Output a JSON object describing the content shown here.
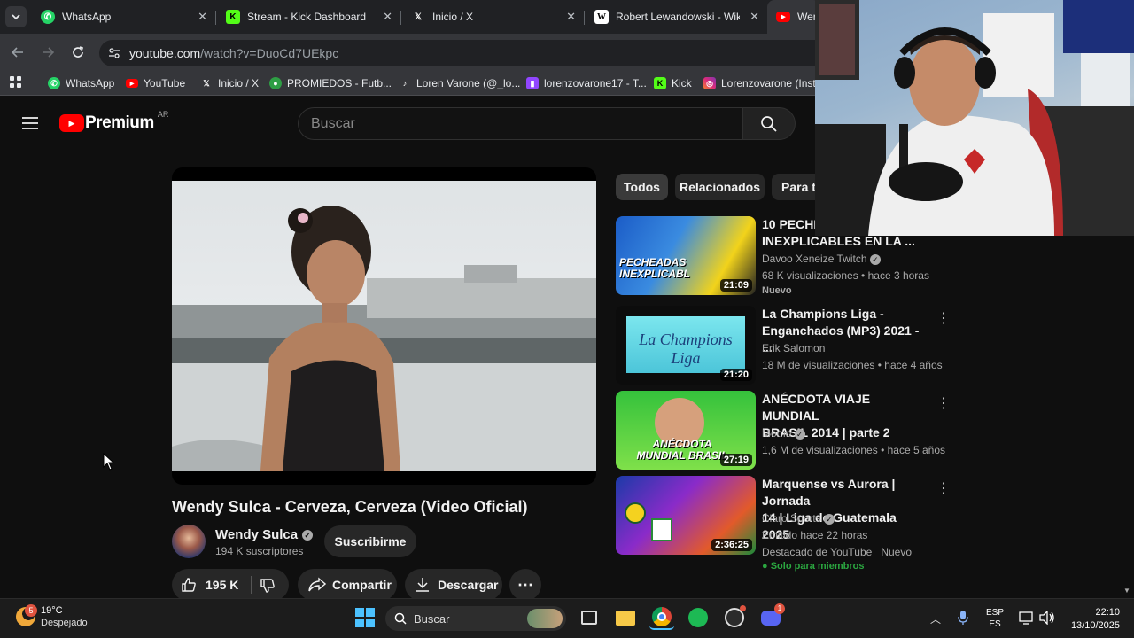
{
  "browser": {
    "tabs": [
      {
        "title": "WhatsApp",
        "icon": "whatsapp-icon"
      },
      {
        "title": "Stream - Kick Dashboard",
        "icon": "kick-icon"
      },
      {
        "title": "Inicio / X",
        "icon": "x-icon"
      },
      {
        "title": "Robert Lewandowski - Wikip",
        "icon": "wikipedia-icon"
      },
      {
        "title": "Wen",
        "icon": "youtube-icon"
      }
    ],
    "url_domain": "youtube.com",
    "url_path": "/watch?v=DuoCd7UEkpc",
    "bookmarks": [
      {
        "label": "WhatsApp",
        "icon": "whatsapp-icon"
      },
      {
        "label": "YouTube",
        "icon": "youtube-icon"
      },
      {
        "label": "Inicio / X",
        "icon": "x-icon"
      },
      {
        "label": "PROMIEDOS - Futb...",
        "icon": "promiedos-icon"
      },
      {
        "label": "Loren Varone (@_lo...",
        "icon": "tiktok-icon"
      },
      {
        "label": "lorenzovarone17 - T...",
        "icon": "twitch-icon"
      },
      {
        "label": "Kick",
        "icon": "kick-icon"
      },
      {
        "label": "Lorenzovarone (Inst...",
        "icon": "instagram-icon"
      }
    ]
  },
  "youtube": {
    "logo_text": "Premium",
    "region": "AR",
    "search_placeholder": "Buscar",
    "chips": [
      "Todos",
      "Relacionados",
      "Para ti"
    ],
    "video": {
      "title": "Wendy Sulca - Cerveza, Cerveza (Video Oficial)",
      "channel": "Wendy Sulca",
      "subscribers": "194 K suscriptores",
      "subscribe_label": "Suscribirme",
      "likes": "195 K",
      "share_label": "Compartir",
      "download_label": "Descargar"
    },
    "recommendations": [
      {
        "title": "10 PECHE... INEXPLICABLES EN LA ...",
        "title_l1": "10 PECHE",
        "title_l2": "INEXPLICABLES EN LA ...",
        "channel": "Davoo Xeneize Twitch",
        "meta": "68 K visualizaciones • hace 3 horas",
        "badge": "Nuevo",
        "duration": "21:09",
        "thumb_text": "PECHEADAS INEXPLICABL"
      },
      {
        "title_l1": "La Champions Liga -",
        "title_l2": "Enganchados (MP3) 2021 - ...",
        "channel": "Erik Salomon",
        "meta": "18 M de visualizaciones • hace 4 años",
        "duration": "21:20",
        "thumb_text": "La Champions Liga"
      },
      {
        "title_l1": "ANÉCDOTA VIAJE MUNDIAL",
        "title_l2": "BRASIL 2014 | parte 2",
        "channel": "Momo",
        "meta": "1,6 M de visualizaciones • hace 5 años",
        "duration": "27:19",
        "thumb_text": "ANÉCDOTA MUNDIAL BRASIL"
      },
      {
        "title_l1": "Marquense vs Aurora | Jornada",
        "title_l2": "14 | Liga de Guatemala 2025",
        "channel": "Claro Sports",
        "meta": "Emitido hace 22 horas",
        "badge_left": "Destacado de YouTube",
        "badge_right": "Nuevo",
        "members": "Solo para miembros",
        "duration": "2:36:25"
      }
    ]
  },
  "taskbar": {
    "weather_temp": "19°C",
    "weather_desc": "Despejado",
    "weather_badge": "5",
    "search_label": "Buscar",
    "lang_line1": "ESP",
    "lang_line2": "ES",
    "time": "22:10",
    "date": "13/10/2025",
    "discord_badge": "1"
  },
  "colors": {
    "yt_red": "#ff0000",
    "verified_gray": "#aaaaaa",
    "members_green": "#2ba640"
  }
}
